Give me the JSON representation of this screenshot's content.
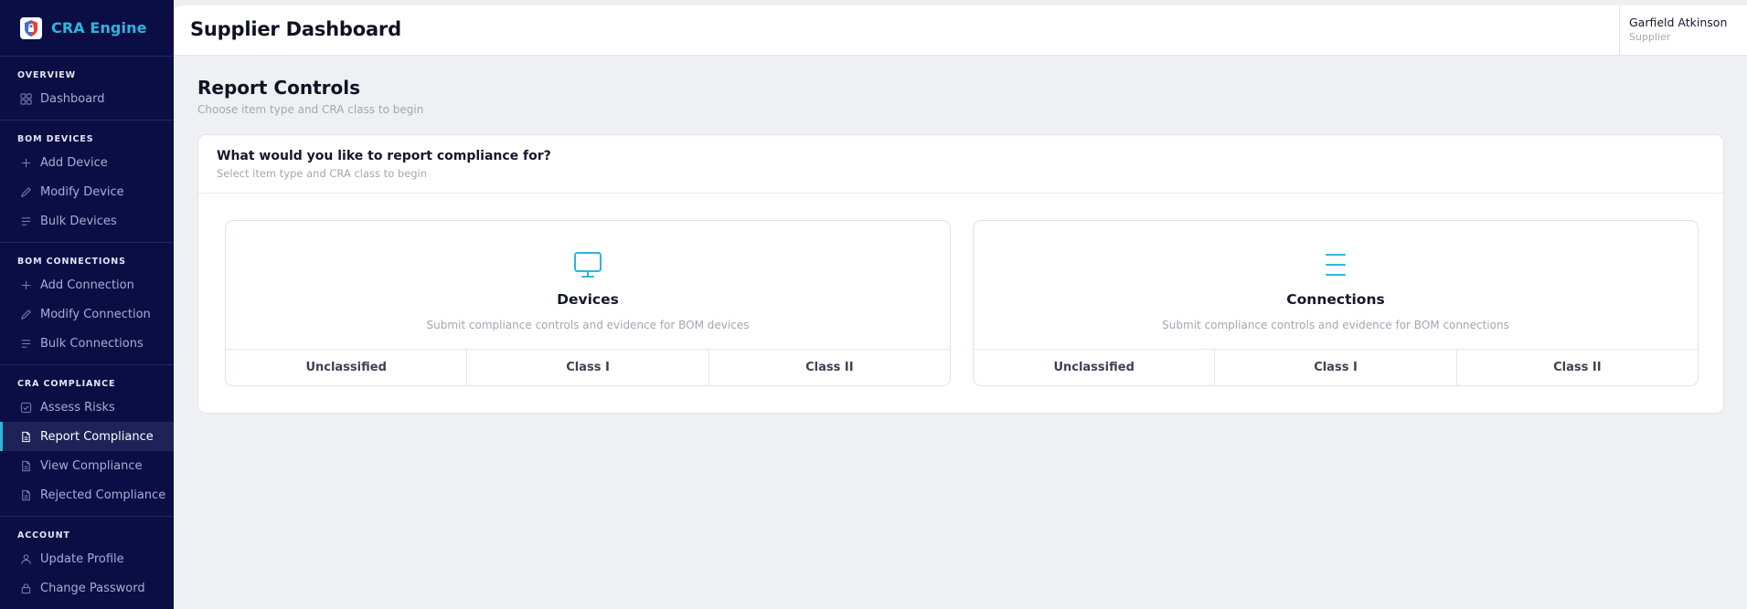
{
  "brand": {
    "name": "CRA Engine"
  },
  "sidebar": {
    "sections": [
      {
        "title": "OVERVIEW",
        "items": [
          {
            "label": "Dashboard",
            "icon": "grid-icon"
          }
        ]
      },
      {
        "title": "BOM DEVICES",
        "items": [
          {
            "label": "Add Device",
            "icon": "plus-icon"
          },
          {
            "label": "Modify Device",
            "icon": "pencil-icon"
          },
          {
            "label": "Bulk Devices",
            "icon": "list-icon"
          }
        ]
      },
      {
        "title": "BOM CONNECTIONS",
        "items": [
          {
            "label": "Add Connection",
            "icon": "plus-icon"
          },
          {
            "label": "Modify Connection",
            "icon": "pencil-icon"
          },
          {
            "label": "Bulk Connections",
            "icon": "list-icon"
          }
        ]
      },
      {
        "title": "CRA COMPLIANCE",
        "items": [
          {
            "label": "Assess Risks",
            "icon": "checkbox-icon"
          },
          {
            "label": "Report Compliance",
            "icon": "document-icon",
            "active": true
          },
          {
            "label": "View Compliance",
            "icon": "document-icon"
          },
          {
            "label": "Rejected Compliance",
            "icon": "document-icon"
          }
        ]
      },
      {
        "title": "ACCOUNT",
        "items": [
          {
            "label": "Update Profile",
            "icon": "user-icon"
          },
          {
            "label": "Change Password",
            "icon": "lock-icon"
          }
        ]
      }
    ]
  },
  "header": {
    "title": "Supplier Dashboard"
  },
  "user": {
    "name": "Garfield Atkinson",
    "role": "Supplier"
  },
  "main": {
    "title": "Report Controls",
    "subtitle": "Choose item type and CRA class to begin",
    "panel": {
      "question": "What would you like to report compliance for?",
      "hint": "Select item type and CRA class to begin",
      "cards": [
        {
          "title": "Devices",
          "description": "Submit compliance controls and evidence for BOM devices",
          "icon": "monitor-icon",
          "classes": [
            "Unclassified",
            "Class I",
            "Class II"
          ]
        },
        {
          "title": "Connections",
          "description": "Submit compliance controls and evidence for BOM connections",
          "icon": "menu-lines-icon",
          "classes": [
            "Unclassified",
            "Class I",
            "Class II"
          ]
        }
      ]
    }
  },
  "colors": {
    "sidebar_bg": "#0b0e45",
    "accent": "#2fb6dd",
    "page_bg": "#eef0f4"
  }
}
